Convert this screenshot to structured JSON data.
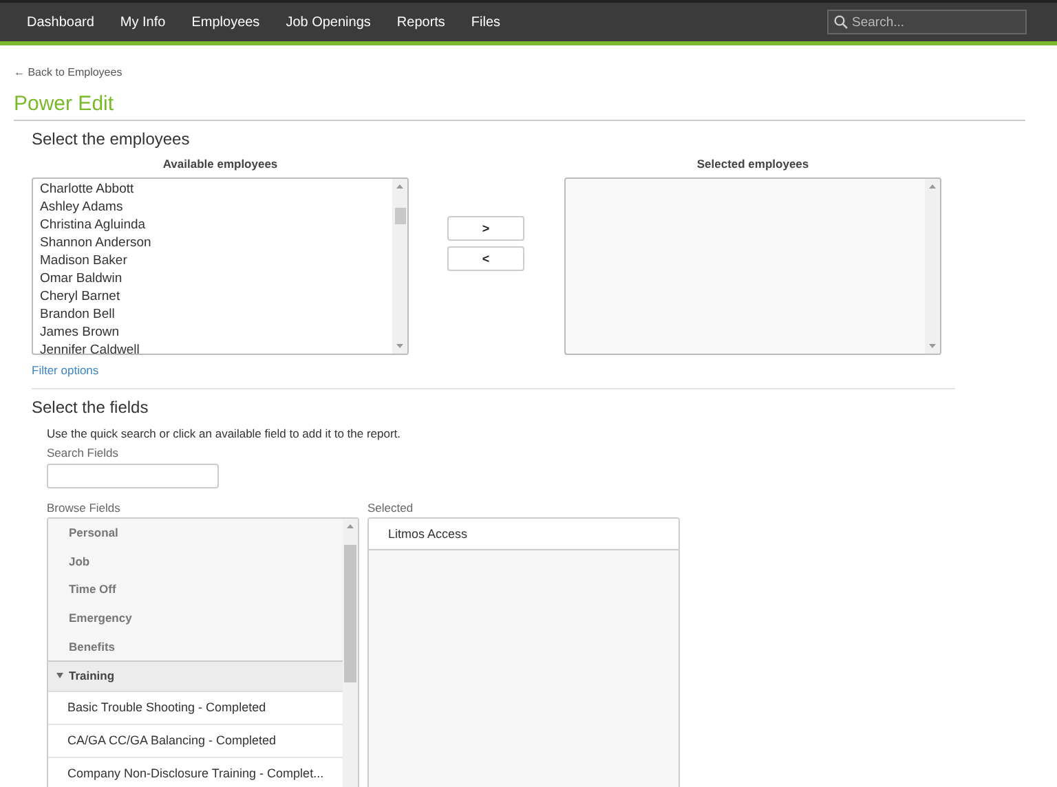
{
  "nav": {
    "items": [
      {
        "label": "Dashboard",
        "selected": false
      },
      {
        "label": "My Info",
        "selected": false
      },
      {
        "label": "Employees",
        "selected": false
      },
      {
        "label": "Job Openings",
        "selected": false
      },
      {
        "label": "Reports",
        "selected": false
      },
      {
        "label": "Files",
        "selected": false
      }
    ],
    "search": {
      "placeholder": "Search..."
    }
  },
  "back_link": "← Back to Employees",
  "title": "Power Edit",
  "employees_section": {
    "heading": "Select the employees",
    "available": {
      "label": "Available employees",
      "items": [
        "Charlotte Abbott",
        "Ashley Adams",
        "Christina Agluinda",
        "Shannon Anderson",
        "Madison Baker",
        "Omar Baldwin",
        "Cheryl Barnet",
        "Brandon Bell",
        "James Brown",
        "Jennifer Caldwell"
      ]
    },
    "move_buttons": [
      ">",
      "<"
    ],
    "selected": {
      "label": "Selected employees"
    },
    "filter_link": "Filter options"
  },
  "fields_section": {
    "heading": "Select the fields",
    "description": "Use the quick search or click an available field to add it to the report.",
    "search": {
      "label": "Search Fields"
    },
    "browse": {
      "label": "Browse Fields",
      "categories": [
        {
          "label": "Personal",
          "expanded": false
        },
        {
          "label": "Job",
          "expanded": false
        },
        {
          "label": "Time Off",
          "expanded": false
        },
        {
          "label": "Emergency",
          "expanded": false
        },
        {
          "label": "Benefits",
          "expanded": false
        },
        {
          "label": "Training",
          "expanded": true,
          "children": [
            "Basic Trouble Shooting - Completed",
            "CA/GA CC/GA Balancing - Completed",
            "Company Non-Disclosure Training - Complet..."
          ]
        }
      ]
    },
    "selected": {
      "label": "Selected",
      "items": [
        "Litmos Access"
      ]
    }
  }
}
